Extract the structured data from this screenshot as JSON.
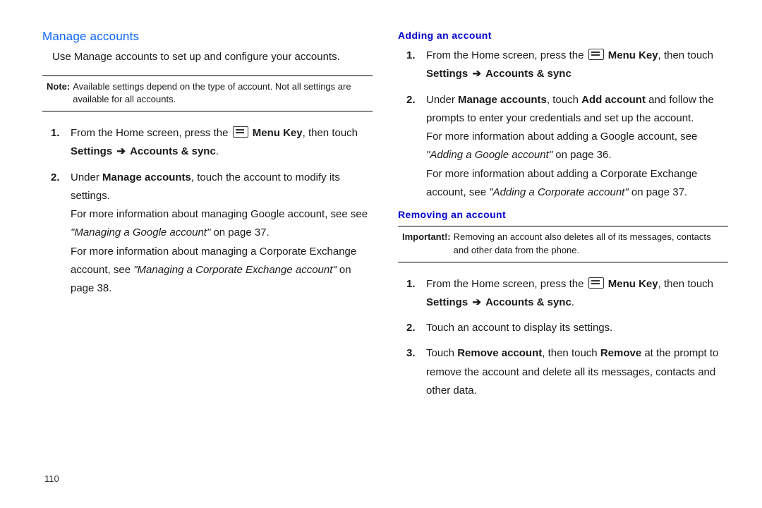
{
  "pageNumber": "110",
  "left": {
    "heading": "Manage accounts",
    "intro": "Use Manage accounts to set up and configure your accounts.",
    "note": {
      "label": "Note:",
      "body": "Available settings depend on the type of account.  Not all settings are available for all accounts."
    },
    "steps": {
      "s1a": "From the Home screen, press the ",
      "s1menu": " Menu Key",
      "s1b": ", then touch ",
      "s1settings": "Settings",
      "s1arrow": " ➔ ",
      "s1sync": "Accounts & sync",
      "s1end": ".",
      "s2a": "Under ",
      "s2manage": "Manage accounts",
      "s2b": ", touch the account to modify its settings.",
      "s2sub1a": "For more information about managing Google account, see see ",
      "s2sub1link": "\"Managing a Google account\"",
      "s2sub1b": " on page 37.",
      "s2sub2a": "For more information about managing a Corporate Exchange account, see ",
      "s2sub2link": "\"Managing a Corporate Exchange account\"",
      "s2sub2b": " on page 38."
    }
  },
  "right": {
    "adding": {
      "heading": "Adding an account",
      "s1a": "From the Home screen, press the ",
      "s1menu": " Menu Key",
      "s1b": ", then touch ",
      "s1settings": "Settings",
      "s1arrow": " ➔ ",
      "s1sync": "Accounts & sync",
      "s2a": "Under ",
      "s2manage": "Manage accounts",
      "s2b": ", touch ",
      "s2add": "Add account",
      "s2c": " and follow the prompts to enter your credentials and set up the account.",
      "s2sub1a": "For more information about adding a Google account, see ",
      "s2sub1link": "\"Adding a Google account\"",
      "s2sub1b": " on page 36.",
      "s2sub2a": "For more information about adding a Corporate Exchange account, see ",
      "s2sub2link": "\"Adding a Corporate account\"",
      "s2sub2b": " on page 37."
    },
    "removing": {
      "heading": "Removing an account",
      "note": {
        "label": "Important!:",
        "body": "Removing an account also deletes all of its messages, contacts and other data from the phone."
      },
      "s1a": "From the Home screen, press the ",
      "s1menu": " Menu Key",
      "s1b": ", then touch ",
      "s1settings": "Settings",
      "s1arrow": " ➔ ",
      "s1sync": "Accounts & sync",
      "s1end": ".",
      "s2": "Touch an account to display its settings.",
      "s3a": "Touch ",
      "s3remacct": "Remove account",
      "s3b": ", then touch ",
      "s3remove": "Remove",
      "s3c": " at the prompt to remove the account and delete all its messages, contacts and other data."
    }
  }
}
